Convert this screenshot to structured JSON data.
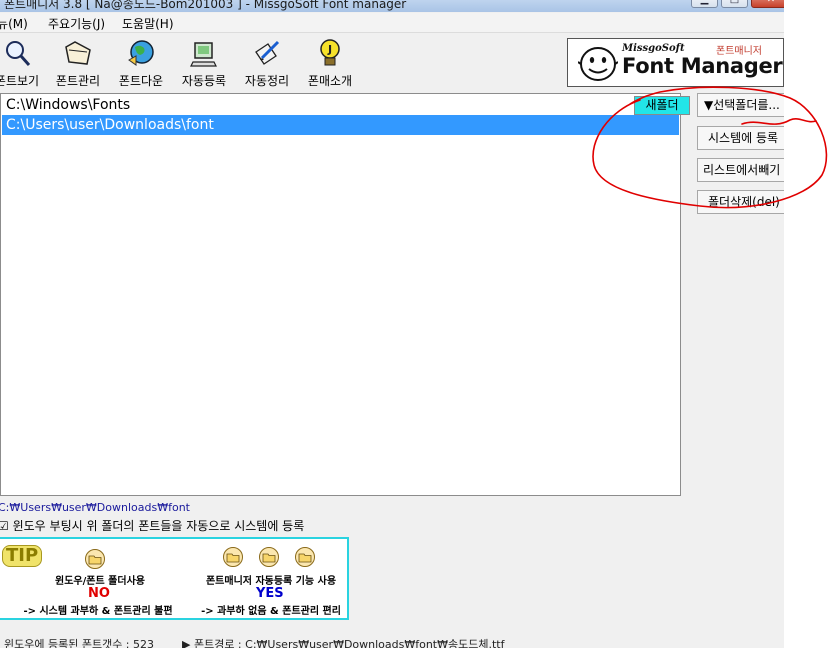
{
  "window": {
    "title": "폰트매니저 3.8 [ Na@송도드-Bom201003 ] - MissgoSoft Font manager"
  },
  "menu": {
    "items": [
      "메뉴(M)",
      "주요기능(J)",
      "도움말(H)"
    ]
  },
  "toolbar": {
    "tools": [
      {
        "label": "폰트보기",
        "icon": "magnifier-icon"
      },
      {
        "label": "폰트관리",
        "icon": "folder-icon"
      },
      {
        "label": "폰트다운",
        "icon": "globe-icon"
      },
      {
        "label": "자동등록",
        "icon": "computer-icon"
      },
      {
        "label": "자동정리",
        "icon": "pen-icon"
      },
      {
        "label": "폰매소개",
        "icon": "lightbulb-icon"
      }
    ],
    "logo": {
      "brand_small": "MissgoSoft",
      "brand_korean": "폰트매니저",
      "brand_big": "Font Manager"
    }
  },
  "folder_list": {
    "rows": [
      {
        "path": "C:\\Windows\\Fonts",
        "selected": false
      },
      {
        "path": "C:\\Users\\user\\Downloads\\font",
        "selected": true
      }
    ],
    "new_folder_button": "새폴더"
  },
  "side_buttons": {
    "select_folder": "▼선택폴더를...",
    "register_system": "시스템에 등록",
    "remove_from_list": "리스트에서빼기",
    "delete_folder": "폴더삭제(del)"
  },
  "bottom": {
    "current_path": "C:₩Users₩user₩Downloads₩font",
    "auto_register_text": "윈도우 부팅시 위 폴더의 폰트들을 자동으로 시스템에 등록",
    "auto_register_checked": true,
    "tip": {
      "badge": "TIP",
      "left_title": "윈도우/폰트 폴더사용",
      "left_answer": "NO",
      "left_desc": "-> 시스템 과부하 & 폰트관리 불편",
      "right_title": "폰트매니저 자동등록 기능 사용",
      "right_answer": "YES",
      "right_desc": "-> 과부하 없음 & 폰트관리 편리"
    }
  },
  "status": {
    "registered_count": "윈도우에 등록된 폰트갯수 : 523",
    "font_path": "▶ 폰트경로 : C:₩Users₩user₩Downloads₩font₩송도드체.ttf"
  },
  "colors": {
    "selection": "#3399ff",
    "new_folder_bg": "#22e5e8",
    "tip_border": "#2ad3e0",
    "annotation": "#e00000"
  }
}
